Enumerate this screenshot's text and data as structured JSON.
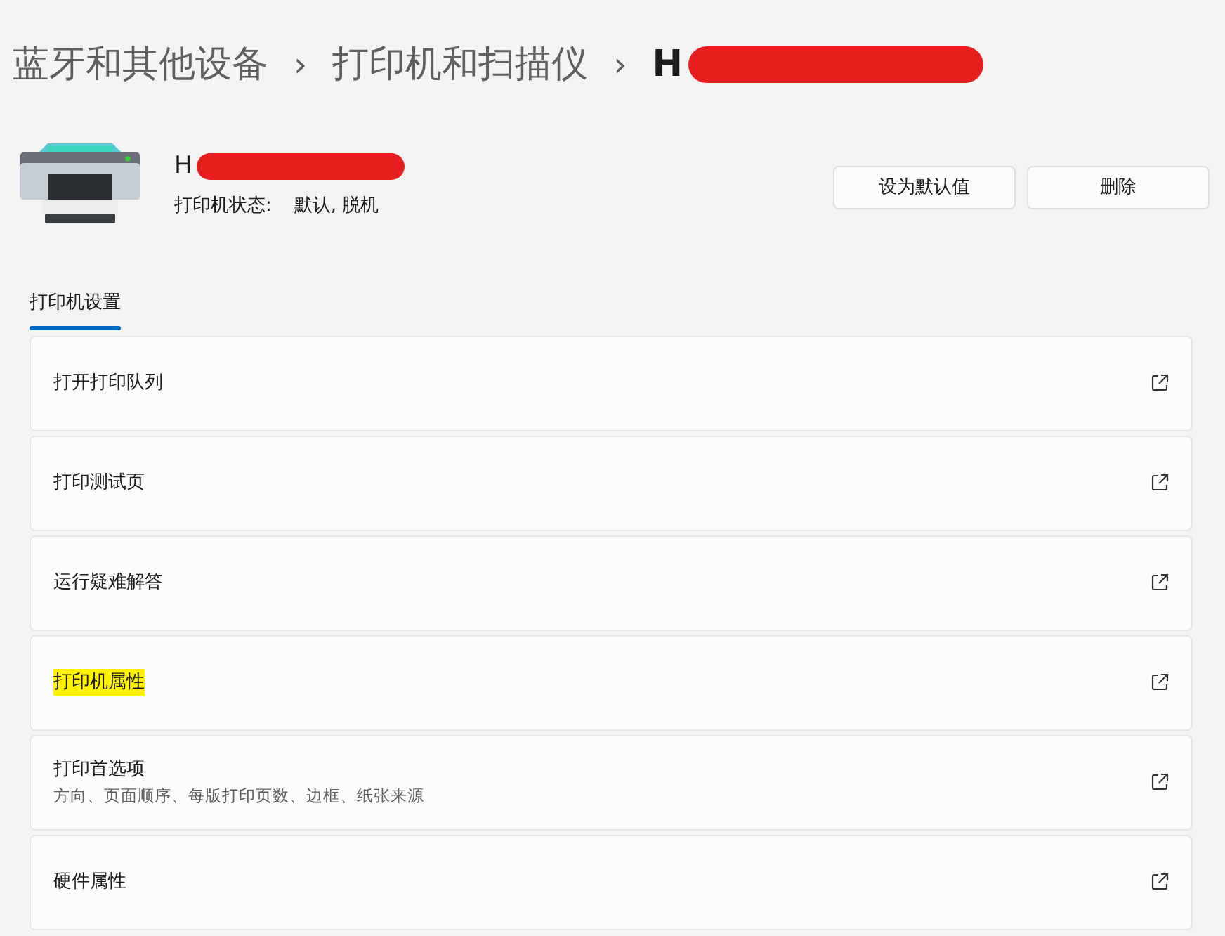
{
  "breadcrumb": [
    {
      "label": "蓝牙和其他设备",
      "current": false
    },
    {
      "label": "打印机和扫描仪",
      "current": false
    },
    {
      "label": "H",
      "current": true,
      "redacted": true
    }
  ],
  "breadcrumb_separator": "›",
  "printer": {
    "name": "H",
    "redacted": true,
    "status_label": "打印机状态:",
    "status_value": "默认, 脱机"
  },
  "buttons": [
    "设为默认值",
    "删除"
  ],
  "tabs": [
    {
      "label": "打印机设置",
      "selected": true
    }
  ],
  "settings": [
    {
      "title": "打开打印队列",
      "highlighted": false
    },
    {
      "title": "打印测试页",
      "highlighted": false
    },
    {
      "title": "运行疑难解答",
      "highlighted": false
    },
    {
      "title": "打印机属性",
      "highlighted": true
    },
    {
      "title": "打印首选项",
      "subtitle": "方向、页面顺序、每版打印页数、边框、纸张来源",
      "highlighted": false
    },
    {
      "title": "硬件属性",
      "highlighted": false
    }
  ]
}
